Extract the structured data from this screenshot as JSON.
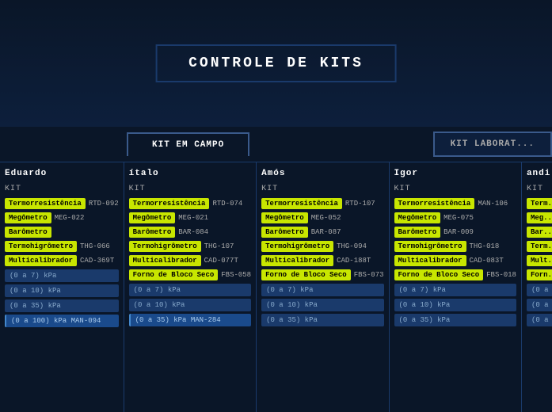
{
  "app": {
    "title": "CONTROLE DE KITS",
    "background": "#0a1628"
  },
  "tabs": {
    "active": "KIT EM CAMPO",
    "inactive": "KIT LABORAT..."
  },
  "columns": [
    {
      "name": "Eduardo",
      "kit_label": "KIT",
      "items": [
        {
          "tag": "Termorresistência",
          "code": "RTD-092"
        },
        {
          "tag": "Megômetro",
          "code": "MEG-022"
        },
        {
          "tag": "Barômetro",
          "code": ""
        },
        {
          "tag": "Termohigrômetro",
          "code": "THG-066"
        },
        {
          "tag": "Multicalibrador",
          "code": "CAD-369T"
        }
      ],
      "pressures": [
        "(0 a 7) kPa",
        "(0 a 10) kPa",
        "(0 a 35) kPa",
        "(0 a 100) kPa"
      ],
      "pressure_code": "MAN-094"
    },
    {
      "name": "ítalo",
      "kit_label": "KIT",
      "items": [
        {
          "tag": "Termorresistência",
          "code": "RTD-074"
        },
        {
          "tag": "Megômetro",
          "code": "MEG-021"
        },
        {
          "tag": "Barômetro",
          "code": "BAR-084"
        },
        {
          "tag": "Termohigrômetro",
          "code": "THG-107"
        },
        {
          "tag": "Multicalibrador",
          "code": "CAD-077T"
        },
        {
          "tag": "Forno de Bloco Seco",
          "code": "FBS-058"
        }
      ],
      "pressures": [
        "(0 a 7) kPa",
        "(0 a 10) kPa",
        "(0 a 35) kPa"
      ],
      "pressure_code": "MAN-284"
    },
    {
      "name": "Amós",
      "kit_label": "KIT",
      "items": [
        {
          "tag": "Termorresistência",
          "code": "RTD-107"
        },
        {
          "tag": "Megômetro",
          "code": "MEG-052"
        },
        {
          "tag": "Barômetro",
          "code": "BAR-087"
        },
        {
          "tag": "Termohigrômetro",
          "code": "THG-094"
        },
        {
          "tag": "Multicalibrador",
          "code": "CAD-188T"
        },
        {
          "tag": "Forno de Bloco Seco",
          "code": "FBS-073"
        }
      ],
      "pressures": [
        "(0 a 7) kPa",
        "(0 a 10) kPa",
        "(0 a 35) kPa"
      ],
      "pressure_code": ""
    },
    {
      "name": "Igor",
      "kit_label": "KIT",
      "items": [
        {
          "tag": "Termorresistência",
          "code": "MAN-106"
        },
        {
          "tag": "Megômetro",
          "code": "MEG-075"
        },
        {
          "tag": "Barômetro",
          "code": "BAR-009"
        },
        {
          "tag": "Termohigrômetro",
          "code": "THG-018"
        },
        {
          "tag": "Multicalibrador",
          "code": "CAD-083T"
        },
        {
          "tag": "Forno de Bloco Seco",
          "code": "FBS-018"
        }
      ],
      "pressures": [
        "(0 a 7) kPa",
        "(0 a 10) kPa",
        "(0 a 35) kPa"
      ],
      "pressure_code": ""
    },
    {
      "name": "andi",
      "kit_label": "KIT",
      "items": [
        {
          "tag": "Term...",
          "code": ""
        },
        {
          "tag": "Meg...",
          "code": ""
        },
        {
          "tag": "Bar...",
          "code": ""
        },
        {
          "tag": "Term...",
          "code": ""
        },
        {
          "tag": "Mult...",
          "code": ""
        },
        {
          "tag": "Forn...",
          "code": ""
        }
      ],
      "pressures": [
        "(0 a ...",
        "(0 a ...",
        "(0 a ..."
      ],
      "pressure_code": ""
    }
  ]
}
